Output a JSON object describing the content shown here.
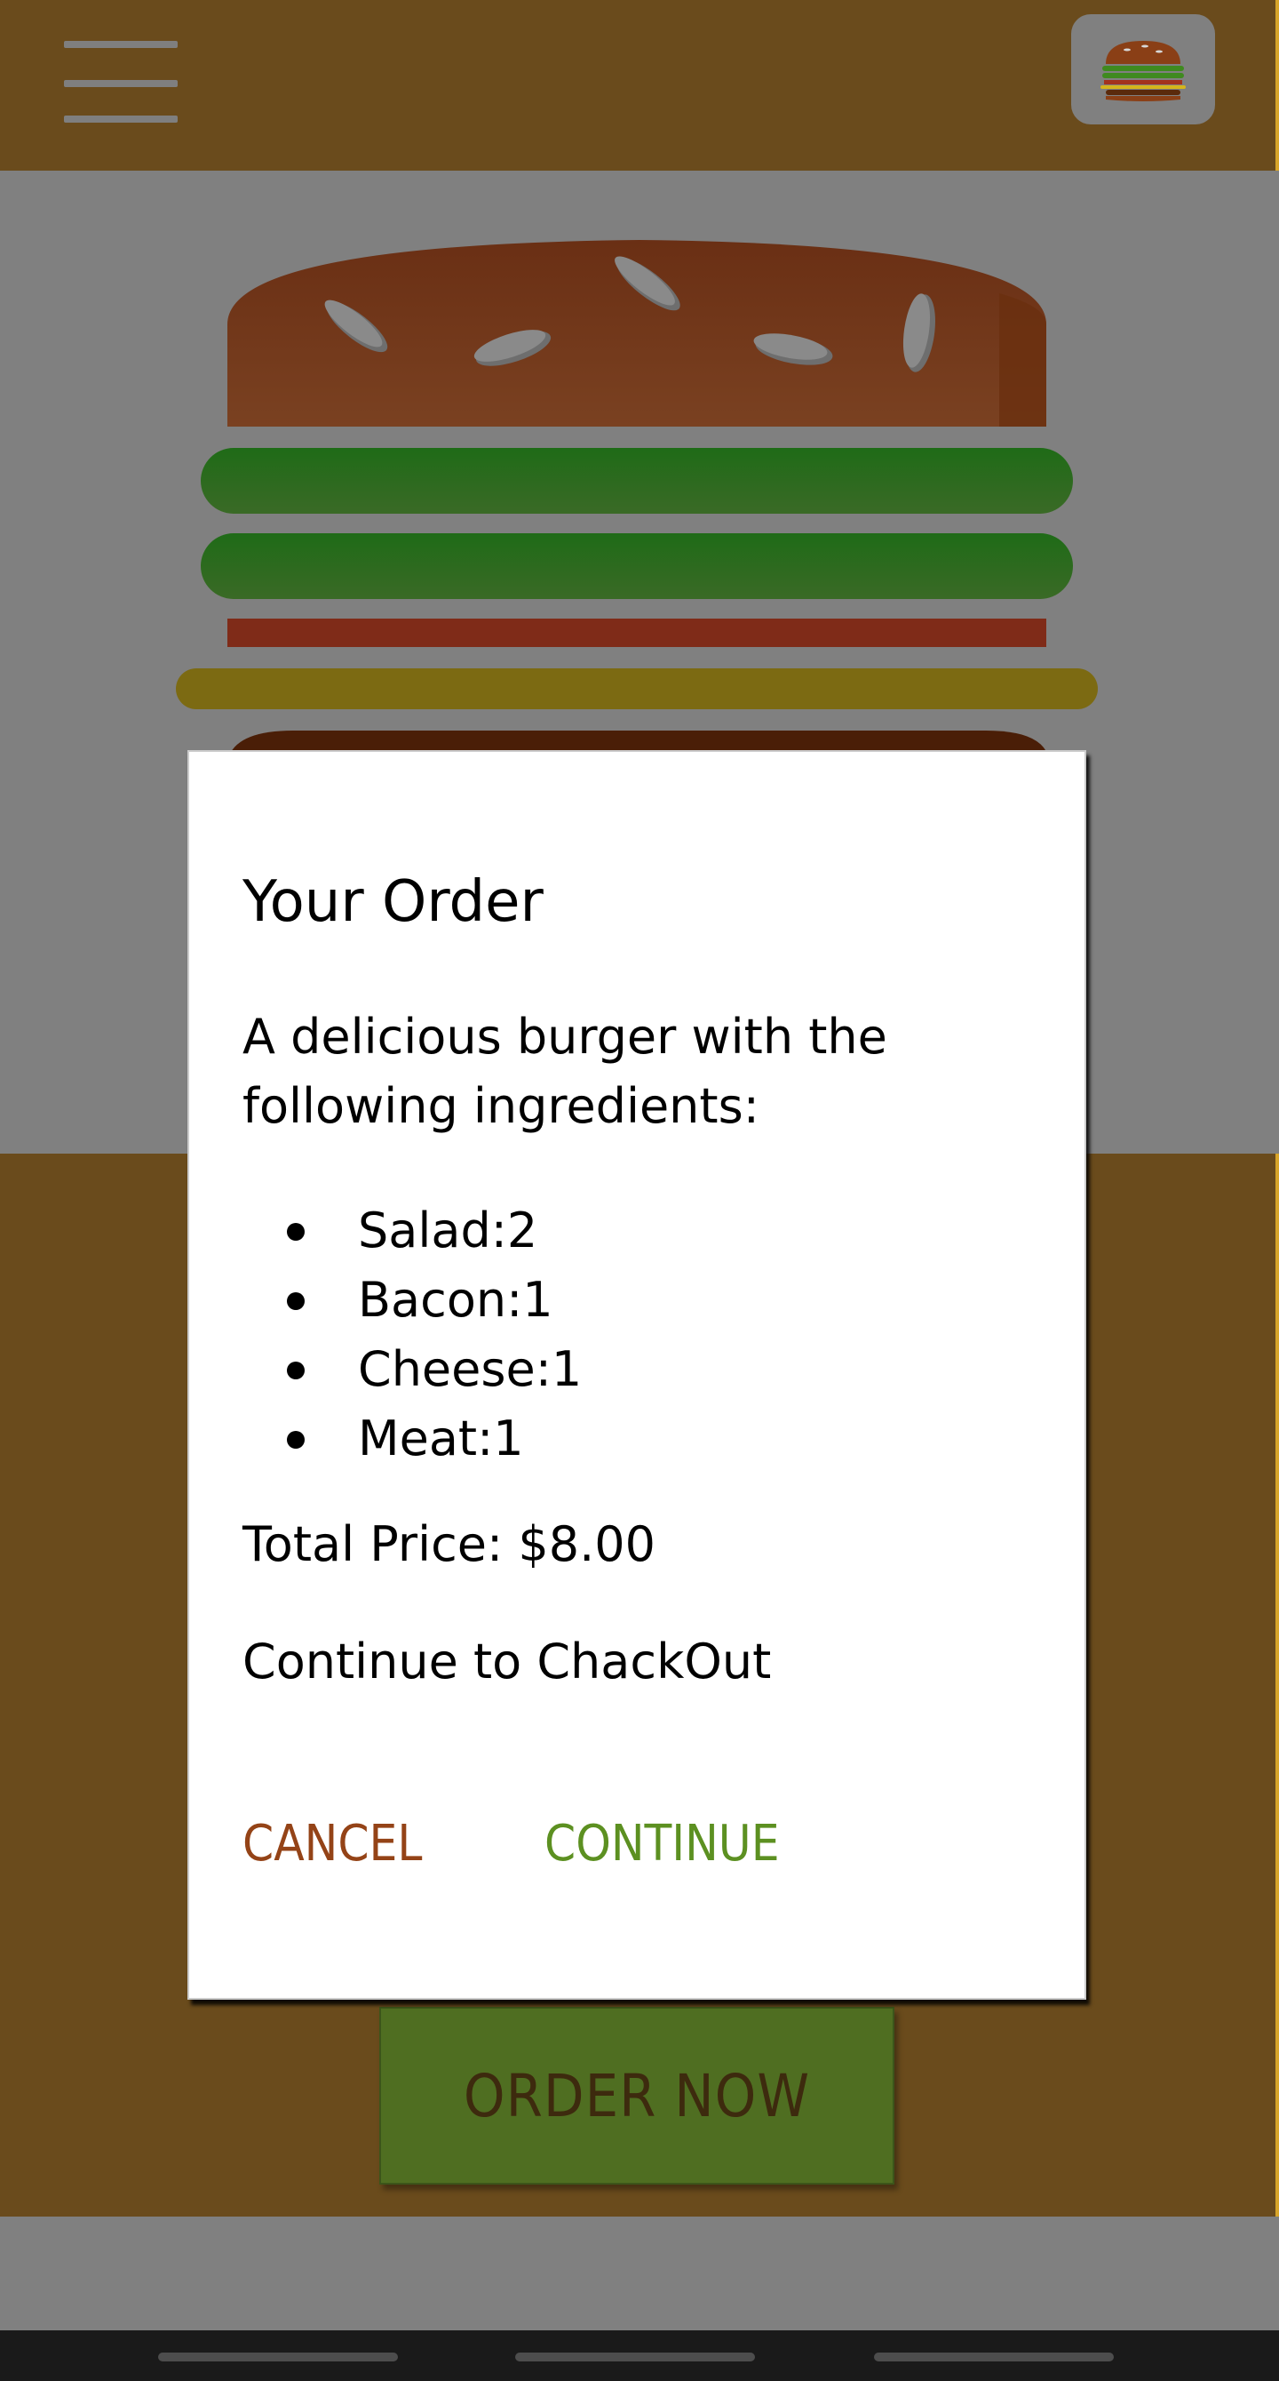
{
  "toolbar": {
    "menu_icon": "hamburger-menu-icon",
    "logo_icon": "burger-logo-icon"
  },
  "order_button": {
    "label": "ORDER NOW"
  },
  "modal": {
    "title": "Your Order",
    "description": "A delicious burger with the following ingredients:",
    "ingredients": [
      {
        "name": "Salad",
        "quantity": 2,
        "text": "Salad:2"
      },
      {
        "name": "Bacon",
        "quantity": 1,
        "text": "Bacon:1"
      },
      {
        "name": "Cheese",
        "quantity": 1,
        "text": "Cheese:1"
      },
      {
        "name": "Meat",
        "quantity": 1,
        "text": "Meat:1"
      }
    ],
    "total_price": "Total Price: $8.00",
    "continue_prompt": "Continue to ChackOut",
    "cancel_label": "CANCEL",
    "continue_label": "CONTINUE"
  },
  "colors": {
    "toolbar": "#6a4b1c",
    "accent_edge": "#d8a52a",
    "cancel": "#944317",
    "continue": "#5c9021",
    "order_button": "#4f6e21"
  }
}
